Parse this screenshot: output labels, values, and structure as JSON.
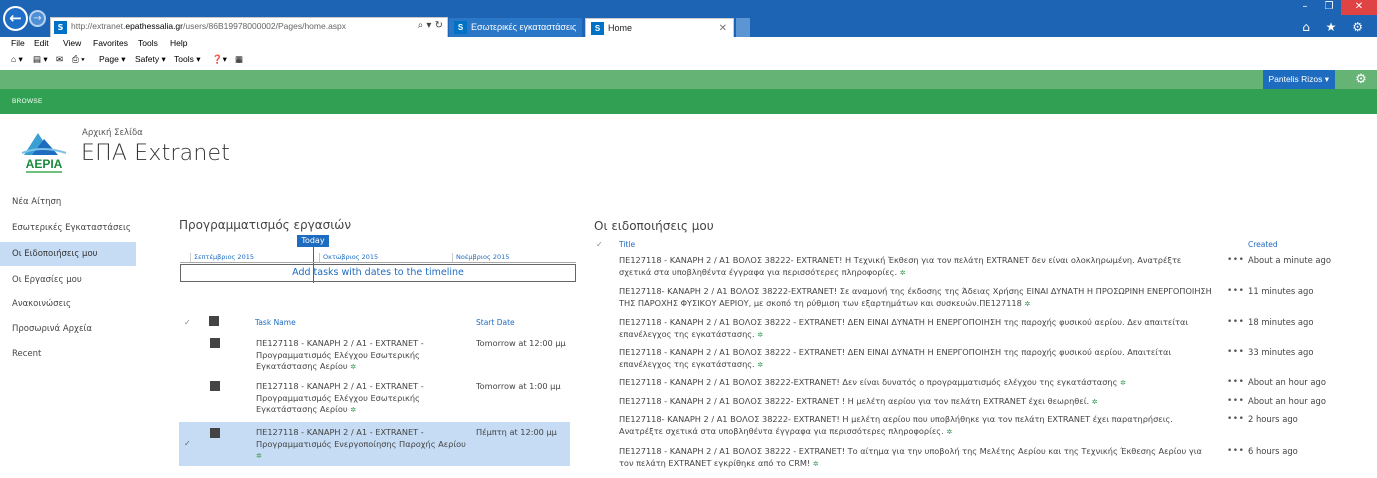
{
  "browser": {
    "url_prefix": "http://extranet.",
    "url_domain": "epathessalia.gr",
    "url_path": "/users/86B19978000002/Pages/home.aspx",
    "address_tools": "⌕ ▾ ↻",
    "tabs": [
      {
        "label": "Εσωτερικές εγκαταστάσεις",
        "active": false
      },
      {
        "label": "Home",
        "active": true
      }
    ],
    "tab_close": "✕",
    "menu": [
      "File",
      "Edit",
      "View",
      "Favorites",
      "Tools",
      "Help"
    ],
    "commands": {
      "page": "Page ▾",
      "safety": "Safety ▾",
      "tools": "Tools ▾"
    },
    "window_controls": {
      "min": "–",
      "max": "❐",
      "close": "✕"
    },
    "right_icons": "⌂ ★ ⚙"
  },
  "suite": {
    "user": "Pantelis Rizos ▾",
    "browse_tab": "BROWSE",
    "bar_color": "#65b476",
    "ribbon_color": "#32a052",
    "accent": "#1e6cc0"
  },
  "header": {
    "breadcrumb": "Αρχική Σελίδα",
    "site_title": "ΕΠΑ Extranet",
    "logo_text": "ΑΕΡΙΑ"
  },
  "leftnav": [
    {
      "label": "Νέα Αίτηση",
      "selected": false
    },
    {
      "label": "Εσωτερικές Εγκαταστάσεις",
      "selected": false
    },
    {
      "label": "Οι Ειδοποιήσεις μου",
      "selected": true
    },
    {
      "label": "Οι Εργασίες μου",
      "selected": false
    },
    {
      "label": "Ανακοινώσεις",
      "selected": false
    },
    {
      "label": "Προσωρινά Αρχεία",
      "selected": false
    },
    {
      "label": "Recent",
      "selected": false
    }
  ],
  "tasks": {
    "title": "Προγραμματισμός εργασιών",
    "timeline": {
      "today_label": "Today",
      "months": [
        "Σεπτέμβριος 2015",
        "Οκτώβριος 2015",
        "Νοέμβριος 2015"
      ],
      "empty_text": "Add tasks with dates to the timeline"
    },
    "columns": {
      "task_name": "Task Name",
      "start_date": "Start Date"
    },
    "rows": [
      {
        "name": "ΠΕ127118 - ΚΑΝΑΡΗ 2 / Α1 - EXTRANET - Προγραμματισμός Ελέγχου Εσωτερικής Εγκατάστασης Αερίου",
        "start": "Tomorrow at 12:00 μμ",
        "selected": false
      },
      {
        "name": "ΠΕ127118 - ΚΑΝΑΡΗ 2 / Α1 - EXTRANET - Προγραμματισμός Ελέγχου Εσωτερικής Εγκατάστασης Αερίου",
        "start": "Tomorrow at 1:00 μμ",
        "selected": false
      },
      {
        "name": "ΠΕ127118 - ΚΑΝΑΡΗ 2 / Α1 - EXTRANET - Προγραμματισμός Ενεργοποίησης Παροχής Αερίου",
        "start": "Πέμπτη at 12:00 μμ",
        "selected": true
      }
    ]
  },
  "notifications": {
    "title": "Οι ειδοποιήσεις μου",
    "columns": {
      "title": "Title",
      "created": "Created"
    },
    "rows": [
      {
        "text": "ΠΕ127118 - ΚΑΝΑΡΗ 2 / Α1 ΒΟΛΟΣ 38222- EXTRANET! Η Τεχνική Έκθεση για τον πελάτη EXTRANET δεν είναι ολοκληρωμένη. Ανατρέξτε σχετικά στα υποβληθέντα έγγραφα για περισσότερες πληροφορίες.",
        "created": "About a minute ago"
      },
      {
        "text": "ΠΕ127118- ΚΑΝΑΡΗ 2 / Α1 ΒΟΛΟΣ 38222-EXTRANET! Σε αναμονή της έκδοσης της Άδειας Χρήσης ΕΙΝΑΙ ΔΥΝΑΤΗ Η ΠΡΟΣΩΡΙΝΗ ΕΝΕΡΓΟΠΟΙΗΣΗ ΤΗΣ ΠΑΡΟΧΗΣ ΦΥΣΙΚΟΥ ΑΕΡΙΟΥ, με σκοπό τη ρύθμιση των εξαρτημάτων και συσκευών.ΠΕ127118",
        "created": "11 minutes ago"
      },
      {
        "text": "ΠΕ127118 - ΚΑΝΑΡΗ 2 / Α1 ΒΟΛΟΣ 38222 - EXTRANET! ΔΕΝ ΕΙΝΑΙ ΔΥΝΑΤΗ Η ΕΝΕΡΓΟΠΟΙΗΣΗ της παροχής φυσικού αερίου. Δεν απαιτείται επανέλεγχος της εγκατάστασης.",
        "created": "18 minutes ago"
      },
      {
        "text": "ΠΕ127118 - ΚΑΝΑΡΗ 2 / Α1 ΒΟΛΟΣ 38222 - EXTRANET! ΔΕΝ ΕΙΝΑΙ ΔΥΝΑΤΗ Η ΕΝΕΡΓΟΠΟΙΗΣΗ της παροχής φυσικού αερίου. Απαιτείται επανέλεγχος της εγκατάστασης.",
        "created": "33 minutes ago"
      },
      {
        "text": "ΠΕ127118 - ΚΑΝΑΡΗ 2 / Α1 ΒΟΛΟΣ 38222-EXTRANET! Δεν είναι δυνατός ο προγραμματισμός ελέγχου της εγκατάστασης",
        "created": "About an hour ago"
      },
      {
        "text": "ΠΕ127118 - ΚΑΝΑΡΗ 2 / Α1 ΒΟΛΟΣ 38222- EXTRANET ! Η μελέτη αερίου για τον πελάτη EXTRANET έχει θεωρηθεί.",
        "created": "About an hour ago"
      },
      {
        "text": "ΠΕ127118- ΚΑΝΑΡΗ 2 / Α1 ΒΟΛΟΣ 38222- EXTRANET! Η μελέτη αερίου που υποβλήθηκε για τον πελάτη EXTRANET έχει παρατηρήσεις. Ανατρέξτε σχετικά στα υποβληθέντα έγγραφα για περισσότερες πληροφορίες.",
        "created": "2 hours ago"
      },
      {
        "text": "ΠΕ127118 - ΚΑΝΑΡΗ 2 / Α1 ΒΟΛΟΣ 38222 - EXTRANET! Το αίτημα για την υποβολή της Μελέτης Αερίου και της Τεχνικής Έκθεσης Αερίου για τον πελάτη EXTRANET εγκρίθηκε από το CRM!",
        "created": "6 hours ago"
      }
    ]
  }
}
